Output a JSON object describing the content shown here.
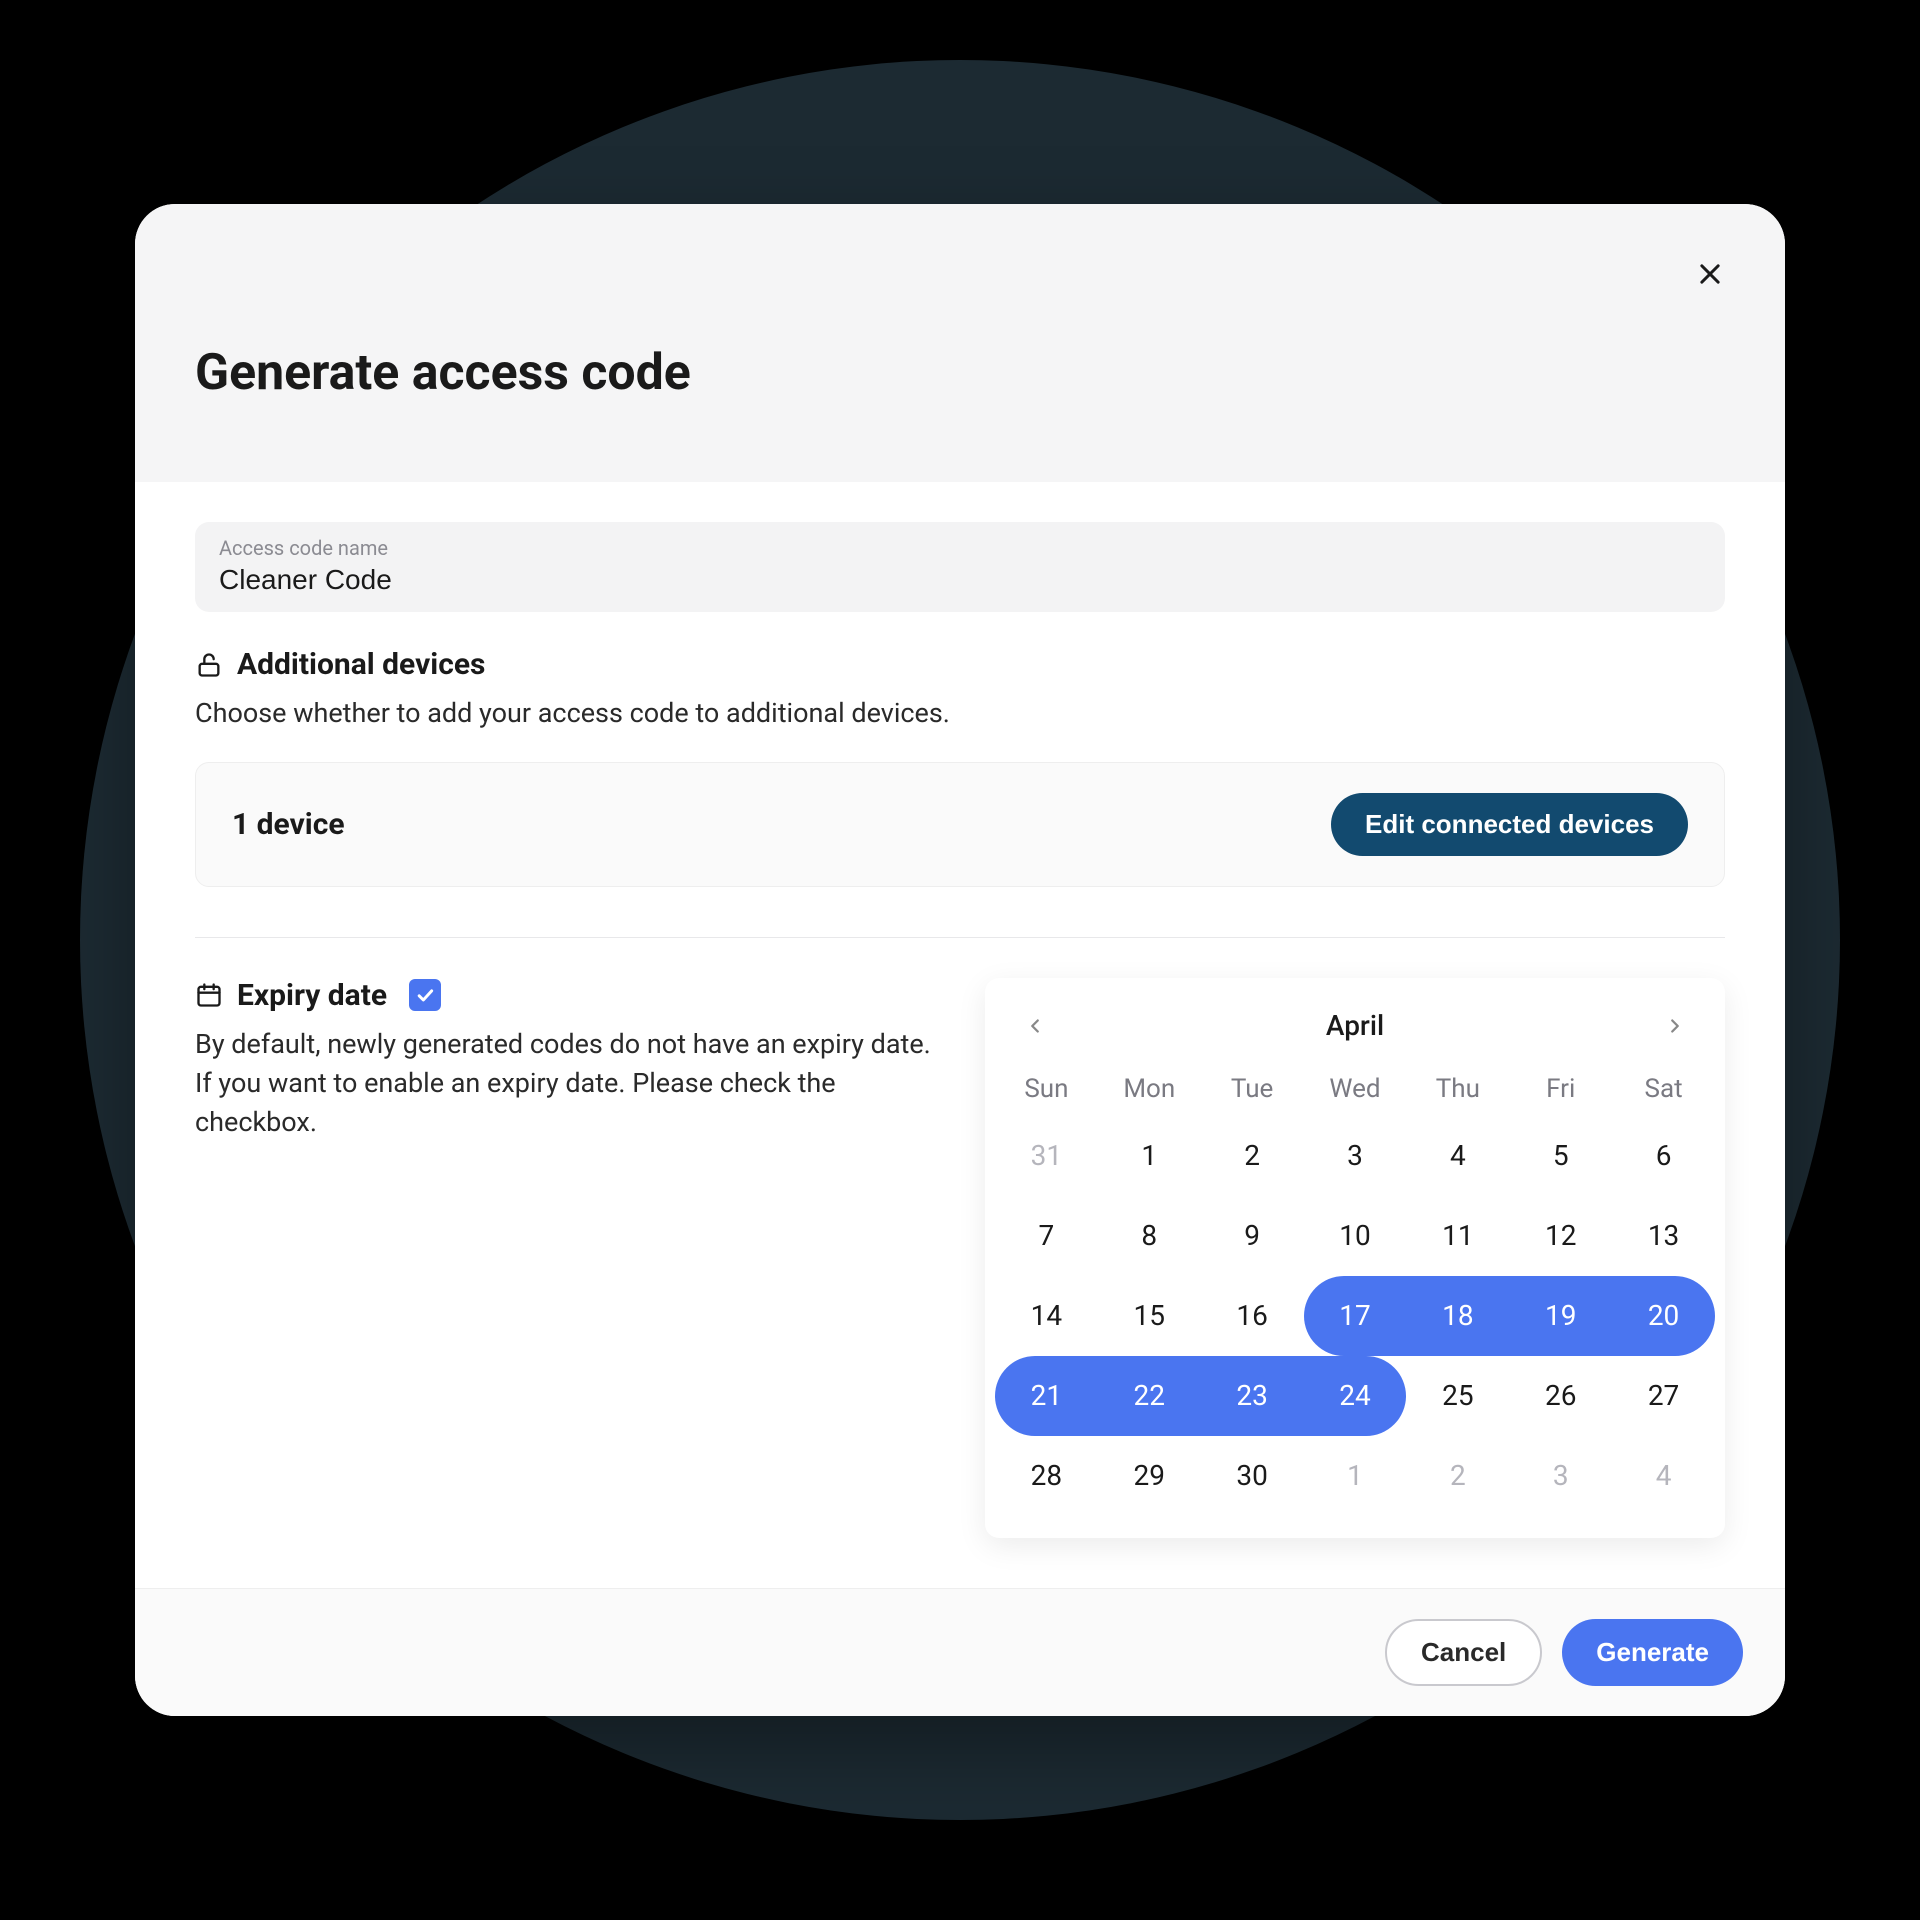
{
  "modal": {
    "title": "Generate access code",
    "close_icon": "close"
  },
  "access_code_name": {
    "label": "Access code name",
    "value": "Cleaner Code"
  },
  "additional_devices": {
    "icon": "unlock",
    "title": "Additional devices",
    "description": "Choose whether to add your access code to additional devices.",
    "count_label": "1 device",
    "edit_button": "Edit connected devices"
  },
  "expiry": {
    "icon": "calendar",
    "title": "Expiry date",
    "checked": true,
    "description": "By default, newly generated codes do not have an expiry date. If you want to enable an expiry date. Please check the checkbox."
  },
  "calendar": {
    "month_label": "April",
    "days_of_week": [
      "Sun",
      "Mon",
      "Tue",
      "Wed",
      "Thu",
      "Fri",
      "Sat"
    ],
    "selected_range": {
      "start": 17,
      "end": 24
    },
    "cells": [
      {
        "n": 31,
        "out": true
      },
      {
        "n": 1
      },
      {
        "n": 2
      },
      {
        "n": 3
      },
      {
        "n": 4
      },
      {
        "n": 5
      },
      {
        "n": 6
      },
      {
        "n": 7
      },
      {
        "n": 8
      },
      {
        "n": 9
      },
      {
        "n": 10
      },
      {
        "n": 11
      },
      {
        "n": 12
      },
      {
        "n": 13
      },
      {
        "n": 14
      },
      {
        "n": 15
      },
      {
        "n": 16
      },
      {
        "n": 17,
        "sel": true,
        "start": true
      },
      {
        "n": 18,
        "sel": true
      },
      {
        "n": 19,
        "sel": true
      },
      {
        "n": 20,
        "sel": true,
        "end_row": true
      },
      {
        "n": 21,
        "sel": true,
        "start_row": true
      },
      {
        "n": 22,
        "sel": true
      },
      {
        "n": 23,
        "sel": true
      },
      {
        "n": 24,
        "sel": true,
        "end": true
      },
      {
        "n": 25
      },
      {
        "n": 26
      },
      {
        "n": 27
      },
      {
        "n": 28
      },
      {
        "n": 29
      },
      {
        "n": 30
      },
      {
        "n": 1,
        "out": true
      },
      {
        "n": 2,
        "out": true
      },
      {
        "n": 3,
        "out": true
      },
      {
        "n": 4,
        "out": true
      }
    ]
  },
  "footer": {
    "cancel": "Cancel",
    "generate": "Generate"
  }
}
